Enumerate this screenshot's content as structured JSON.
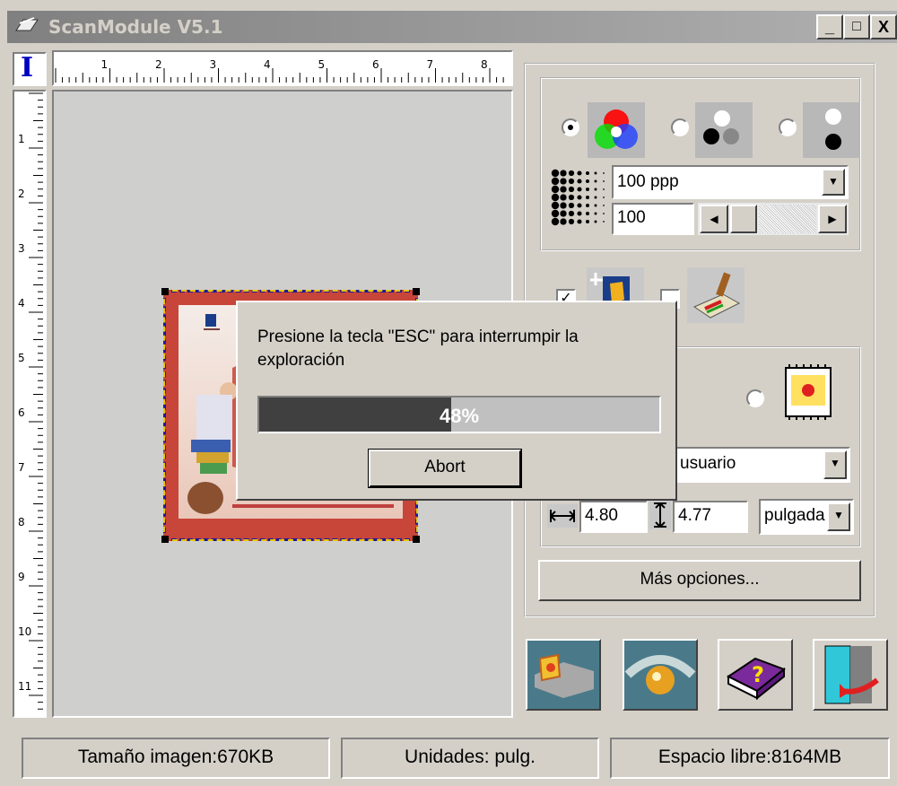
{
  "window": {
    "title": "ScanModule V5.1",
    "controls": {
      "minimize": "_",
      "maximize": "□",
      "close": "X"
    }
  },
  "ruler": {
    "top_numbers": [
      "1",
      "2",
      "3",
      "4",
      "5",
      "6",
      "7",
      "8"
    ],
    "left_numbers": [
      "1",
      "2",
      "3",
      "4",
      "5",
      "6",
      "7",
      "8",
      "9",
      "10",
      "11"
    ],
    "corner_glyph": "I"
  },
  "dialog": {
    "message": "Presione la tecla \"ESC\" para interrumpir la exploración",
    "progress_percent": 48,
    "progress_label": "48%",
    "abort_label": "Abort"
  },
  "color_modes": {
    "items": [
      {
        "name": "color",
        "selected": true,
        "icon": "rgb-circles-icon"
      },
      {
        "name": "grayscale",
        "selected": false,
        "icon": "gray-dots-icon"
      },
      {
        "name": "black-white",
        "selected": false,
        "icon": "bw-dots-icon"
      }
    ]
  },
  "resolution": {
    "value": "100 ppp",
    "icon": "halftone-dots-icon"
  },
  "brightness": {
    "value": "100"
  },
  "options": {
    "auto_crop_checked": true,
    "filter_checked": false,
    "auto_crop_icon": "crop-hand-icon",
    "filter_icon": "scanner-brush-icon"
  },
  "size": {
    "preset": "usuario",
    "width": "4.80",
    "height": "4.77",
    "units": "pulgadа",
    "custom_icon": "film-frame-icon"
  },
  "more_options_label": "Más opciones...",
  "action_buttons": [
    {
      "name": "preview-button",
      "icon": "preview-scan-icon"
    },
    {
      "name": "scan-button",
      "icon": "scan-eye-icon"
    },
    {
      "name": "help-button",
      "icon": "help-book-icon"
    },
    {
      "name": "exit-button",
      "icon": "exit-door-icon"
    }
  ],
  "status": {
    "size": "Tamaño imagen:670KB",
    "units": "Unidades: pulg.",
    "free": "Espacio libre:8164MB"
  },
  "colors": {
    "progress_fill": "#404040",
    "selection_border": "#1a1a9a",
    "image_frame": "#c8453a"
  }
}
